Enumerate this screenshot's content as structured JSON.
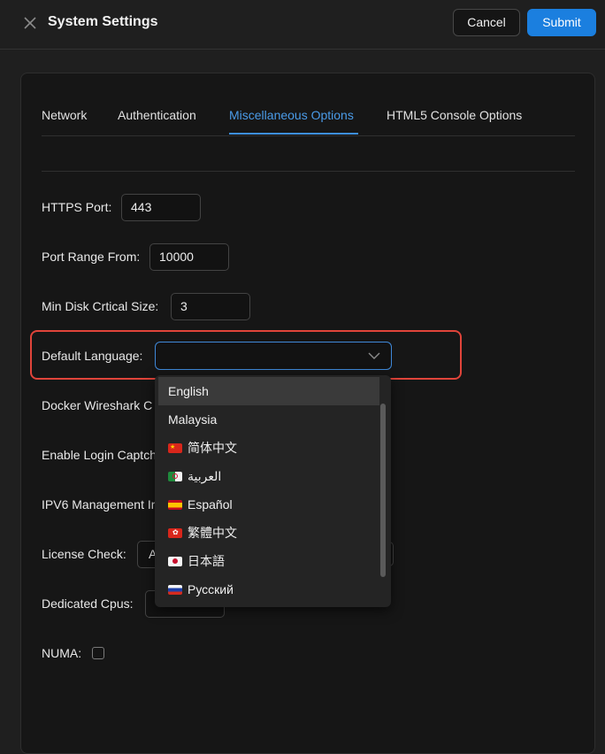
{
  "header": {
    "title": "System Settings",
    "cancel_label": "Cancel",
    "submit_label": "Submit"
  },
  "tabs": [
    {
      "label": "Network"
    },
    {
      "label": "Authentication"
    },
    {
      "label": "Miscellaneous Options",
      "active": true
    },
    {
      "label": "HTML5 Console Options"
    }
  ],
  "fields": {
    "https_port": {
      "label": "HTTPS Port:",
      "value": "443"
    },
    "port_range_from": {
      "label": "Port Range From:",
      "value": "10000"
    },
    "min_disk": {
      "label": "Min Disk Crtical Size:",
      "value": "3"
    },
    "default_language": {
      "label": "Default Language:",
      "value": ""
    },
    "docker_wireshark": {
      "label": "Docker Wireshark C"
    },
    "login_captcha": {
      "label": "Enable Login Captch"
    },
    "ipv6": {
      "label": "IPV6 Management In"
    },
    "license_check": {
      "label": "License Check:",
      "value_partial": "A"
    },
    "dedicated_cpus": {
      "label": "Dedicated Cpus:"
    },
    "numa": {
      "label": "NUMA:",
      "checked": false
    }
  },
  "language_options": [
    {
      "label": "English",
      "flag": "",
      "selected": true
    },
    {
      "label": "Malaysia",
      "flag": ""
    },
    {
      "label": "简体中文",
      "flag": "china-flag-icon"
    },
    {
      "label": "العربية",
      "flag": "algeria-flag-icon"
    },
    {
      "label": "Español",
      "flag": "spain-flag-icon"
    },
    {
      "label": "繁體中文",
      "flag": "hong-kong-flag-icon"
    },
    {
      "label": "日本語",
      "flag": "japan-flag-icon"
    },
    {
      "label": "Русский",
      "flag": "russia-flag-icon"
    }
  ],
  "colors": {
    "accent": "#1b7fdf",
    "highlight_border": "#e0443a",
    "background": "#1f1f1f"
  }
}
